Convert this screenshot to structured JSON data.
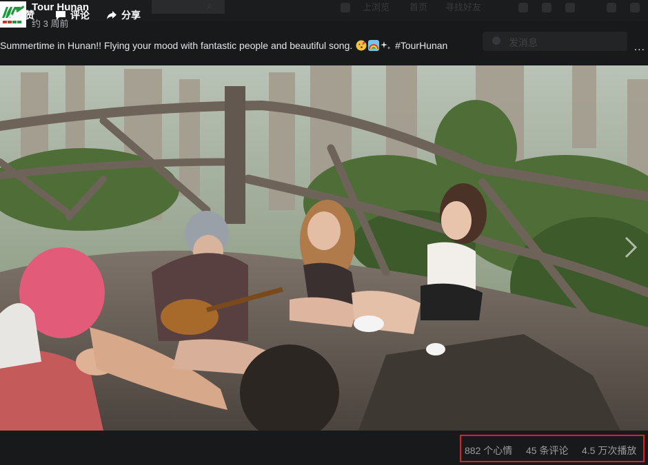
{
  "background": {
    "nav": [
      "上浏览",
      "首页",
      "寻找好友"
    ],
    "post_label": "发消息"
  },
  "post": {
    "page_name": "Tour Hunan",
    "timestamp": "约 3 周前",
    "caption_text": "Summertime in Hunan!! Flying your mood with fantastic people and beautiful song.",
    "caption_emojis": [
      "kiss-emoji",
      "rainbow-emoji",
      "sparkles-emoji"
    ],
    "hashtag": "#TourHunan",
    "more_label": "..."
  },
  "video": {
    "description": "people playing guitar and singing on mountain overlook",
    "next_icon": "chevron-right-icon"
  },
  "actions": {
    "like_label": "赞",
    "comment_label": "评论",
    "share_label": "分享"
  },
  "stats": {
    "reactions": "882 个心情",
    "comments": "45 条评论",
    "views": "4.5 万次播放"
  },
  "colors": {
    "background": "#18191a",
    "highlight_box": "#e02020",
    "logo_green": "#1a9a3a"
  }
}
